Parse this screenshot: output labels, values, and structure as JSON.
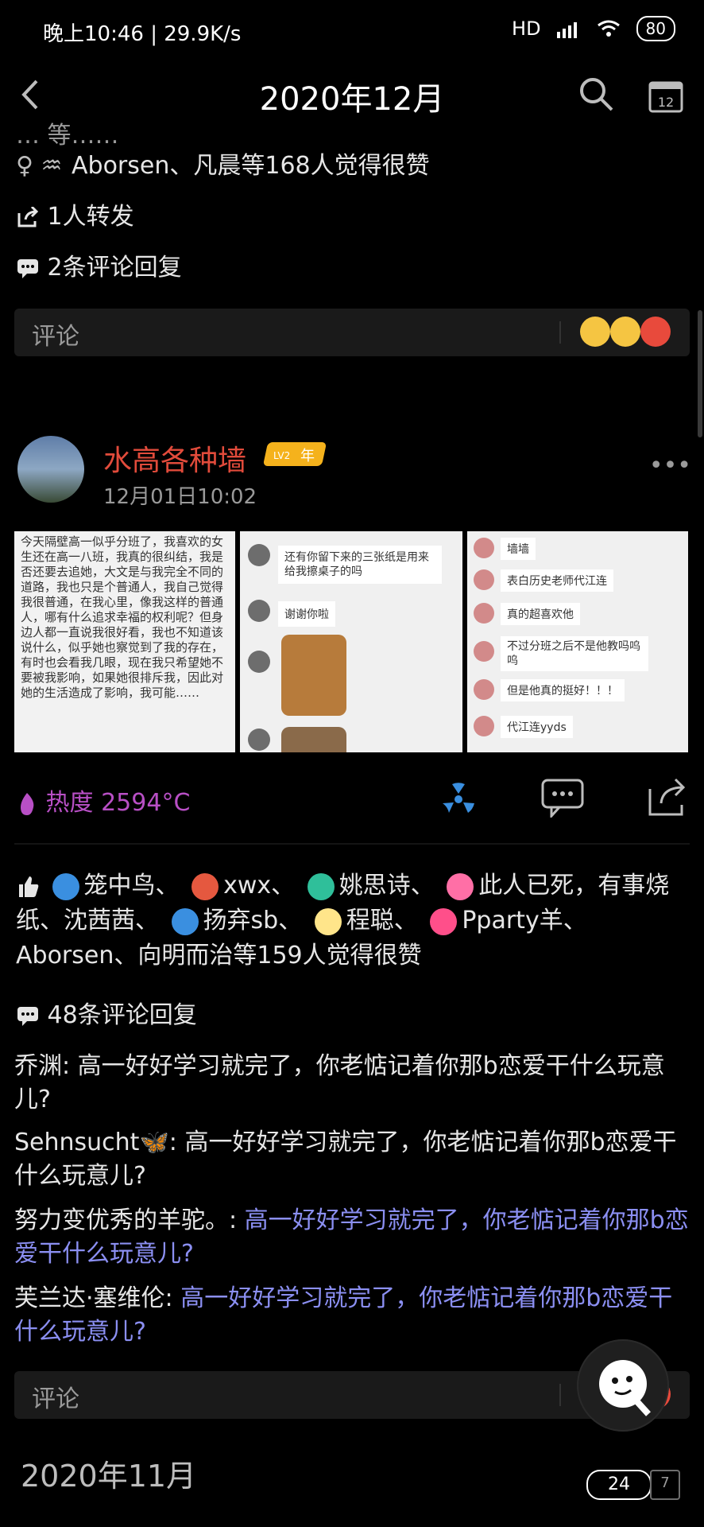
{
  "status_bar": {
    "time_speed": "晚上10:46 | 29.9K/s",
    "network": "HD",
    "battery": "80"
  },
  "header": {
    "title": "2020年12月"
  },
  "post1": {
    "partial_top": "… 等……",
    "likes_line": "Aborsen、凡晨等168人觉得很赞",
    "repost": "1人转发",
    "comments_count": "2条评论回复",
    "comment_placeholder": "评论"
  },
  "post2": {
    "username": "水高各种墙",
    "badge_text": "年",
    "badge_level": "LV2",
    "timestamp": "12月01日10:02",
    "images": [
      {
        "type": "text",
        "content": "今天隔壁高一似乎分班了，我喜欢的女生还在高一八班，我真的很纠结，我是否还要去追她，大文是与我完全不同的道路，我也只是个普通人，我自己觉得我很普通，在我心里，像我这样的普通人，哪有什么追求幸福的权利呢？但身边人都一直说我很好看，我也不知道该说什么，似乎她也察觉到了我的存在，有时也会看我几眼，现在我只希望她不要被我影响，如果她很排斥我，因此对她的生活造成了影响，我可能……"
      },
      {
        "type": "chat",
        "bubbles": [
          "还有你留下来的三张纸是用来给我擦桌子的吗",
          "谢谢你啦"
        ]
      },
      {
        "type": "chat",
        "bubbles": [
          "墙墙",
          "表白历史老师代江连",
          "真的超喜欢他",
          "不过分班之后不是他教吗呜呜",
          "但是他真的挺好！！！",
          "代江连yyds"
        ]
      }
    ],
    "heat_label": "热度",
    "heat_value": "2594°C",
    "likes": {
      "names": [
        "笼中鸟",
        "xwx",
        "姚思诗",
        "此人已死，有事烧纸",
        "沈茜茜",
        "扬弃sb",
        "程聪",
        "Pparty羊",
        "Aborsen",
        "向明而治"
      ],
      "tail": "等159人觉得很赞"
    },
    "comments_count": "48条评论回复",
    "comments": [
      {
        "author": "乔渊",
        "text": "高一好好学习就完了，你老惦记着你那b恋爱干什么玩意儿?"
      },
      {
        "author": "Sehnsucht🦋",
        "text": "高一好好学习就完了，你老惦记着你那b恋爱干什么玩意儿?"
      },
      {
        "author": "努力变优秀的羊驼。",
        "text": "高一好好学习就完了，你老惦记着你那b恋爱干什么玩意儿?"
      },
      {
        "author": "芙兰达·塞维伦",
        "text": "高一好好学习就完了，你老惦记着你那b恋爱干什么玩意儿?"
      }
    ],
    "comment_placeholder": "评论"
  },
  "footer": {
    "month": "2020年11月",
    "page": "24",
    "calendar_day": "7"
  },
  "colors": {
    "username": "#e24b3b",
    "heat": "#b84fc5",
    "blue_text": "#8b8ff2",
    "badge": "#f5b21c"
  }
}
